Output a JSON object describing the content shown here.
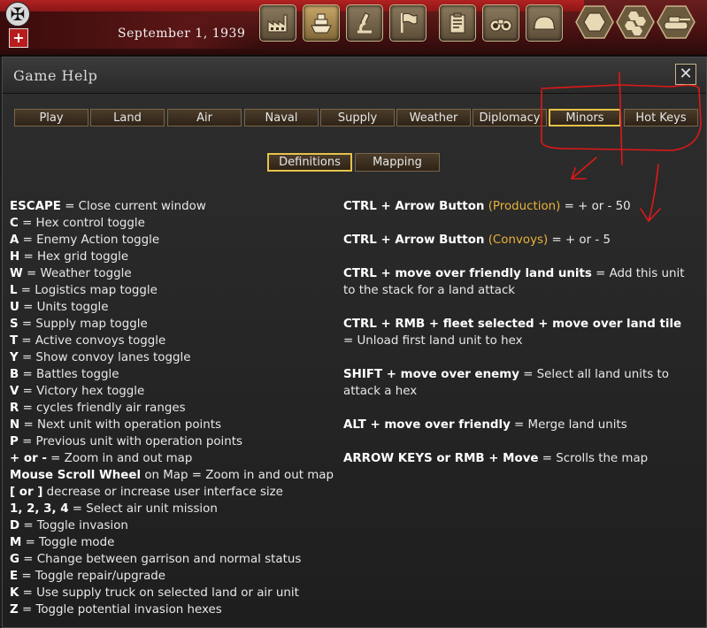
{
  "topbar": {
    "date": "September 1, 1939",
    "buttons": [
      {
        "name": "production-button",
        "icon": "factory-icon"
      },
      {
        "name": "naval-button",
        "icon": "ship-icon",
        "active": true
      },
      {
        "name": "research-button",
        "icon": "microscope-icon"
      },
      {
        "name": "diplomacy-flag-button",
        "icon": "flag-icon"
      },
      {
        "name": "orders-button",
        "icon": "clipboard-icon"
      },
      {
        "name": "intel-button",
        "icon": "binoculars-icon"
      },
      {
        "name": "military-button",
        "icon": "helmet-icon"
      }
    ],
    "hex_buttons": [
      {
        "name": "hex-single-button",
        "icon": "hex-icon"
      },
      {
        "name": "hex-grid-button",
        "icon": "hex-grid-icon"
      },
      {
        "name": "unit-hex-button",
        "icon": "tank-icon"
      }
    ]
  },
  "dialog": {
    "title": "Game Help",
    "close": "✕",
    "tabs": [
      "Play",
      "Land",
      "Air",
      "Naval",
      "Supply",
      "Weather",
      "Diplomacy",
      "Minors",
      "Hot Keys"
    ],
    "selected_tab": "Minors",
    "subtabs": [
      "Definitions",
      "Mapping"
    ],
    "selected_subtab": "Definitions"
  },
  "hotkeys_left": [
    {
      "key": "ESCAPE",
      "desc": " = Close current window"
    },
    {
      "key": "C",
      "desc": " = Hex control toggle"
    },
    {
      "key": "A",
      "desc": " = Enemy Action toggle"
    },
    {
      "key": "H",
      "desc": " = Hex grid toggle"
    },
    {
      "key": "W",
      "desc": " = Weather toggle"
    },
    {
      "key": "L",
      "desc": " = Logistics map toggle"
    },
    {
      "key": "U",
      "desc": " = Units toggle"
    },
    {
      "key": "S",
      "desc": " = Supply map toggle"
    },
    {
      "key": "T",
      "desc": " = Active convoys toggle"
    },
    {
      "key": "Y",
      "desc": " = Show convoy lanes toggle"
    },
    {
      "key": "B",
      "desc": " = Battles toggle"
    },
    {
      "key": "V",
      "desc": " = Victory hex toggle"
    },
    {
      "key": "R",
      "desc": " = cycles friendly air ranges"
    },
    {
      "key": "N",
      "desc": " = Next unit with operation points"
    },
    {
      "key": "P",
      "desc": " = Previous unit with operation points"
    },
    {
      "key": "+ or -",
      "desc": " = Zoom in and out map"
    },
    {
      "key": "Mouse Scroll Wheel",
      "desc": " on Map = Zoom in and out map"
    },
    {
      "key": "[ or ]",
      "desc": " decrease or increase user interface size"
    },
    {
      "key": "1, 2, 3, 4",
      "desc": " = Select air unit mission"
    },
    {
      "key": "D",
      "desc": " = Toggle invasion"
    },
    {
      "key": "M",
      "desc": " = Toggle mode"
    },
    {
      "key": "G",
      "desc": " = Change between garrison and normal status"
    },
    {
      "key": "E",
      "desc": " = Toggle repair/upgrade"
    },
    {
      "key": "K",
      "desc": " = Use supply truck on selected land or air unit"
    },
    {
      "key": "Z",
      "desc": " = Toggle potential invasion hexes"
    }
  ],
  "hotkeys_right": [
    {
      "key": "CTRL + Arrow Button",
      "highlight": " (Production)",
      "desc": " = + or - 50"
    },
    {
      "key": "CTRL + Arrow Button",
      "highlight": " (Convoys)",
      "desc": " = + or - 5"
    },
    {
      "key": "CTRL + move over friendly land units",
      "highlight": "",
      "desc": " = Add this unit to the stack for a land attack"
    },
    {
      "key": "CTRL + RMB + fleet selected + move over land tile",
      "highlight": "",
      "desc": " = Unload first land unit to hex"
    },
    {
      "key": "SHIFT + move over enemy",
      "highlight": "",
      "desc": " = Select all land units to attack a hex"
    },
    {
      "key": "ALT + move over friendly",
      "highlight": "",
      "desc": " = Merge land units"
    },
    {
      "key": "ARROW KEYS or RMB + Move",
      "highlight": "",
      "desc": " = Scrolls the map"
    }
  ],
  "colors": {
    "highlight": "#e8b23a",
    "selected_border": "#e6c24a",
    "annotation": "#e01818"
  }
}
